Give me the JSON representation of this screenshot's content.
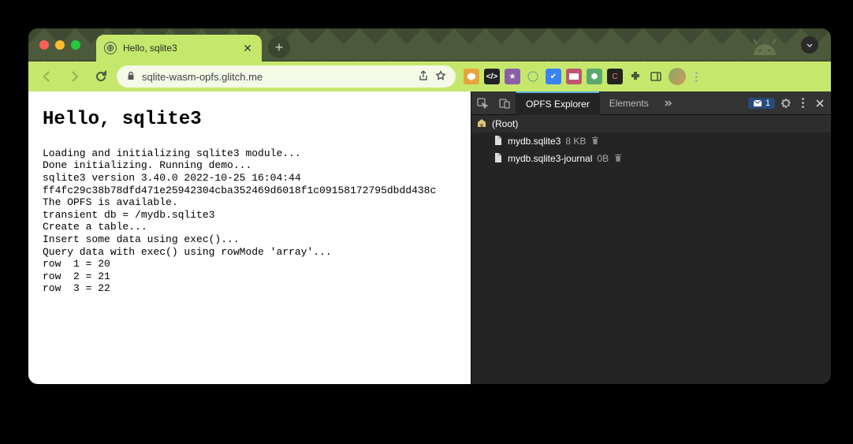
{
  "window": {
    "tab_title": "Hello, sqlite3"
  },
  "toolbar": {
    "url": "sqlite-wasm-opfs.glitch.me"
  },
  "page": {
    "heading": "Hello, sqlite3",
    "log": [
      "Loading and initializing sqlite3 module...",
      "Done initializing. Running demo...",
      "sqlite3 version 3.40.0 2022-10-25 16:04:44",
      "ff4fc29c38b78dfd471e25942304cba352469d6018f1c09158172795dbdd438c",
      "The OPFS is available.",
      "transient db = /mydb.sqlite3",
      "Create a table...",
      "Insert some data using exec()...",
      "Query data with exec() using rowMode 'array'...",
      "row  1 = 20",
      "row  2 = 21",
      "row  3 = 22"
    ]
  },
  "devtools": {
    "tabs": {
      "active": "OPFS Explorer",
      "other": "Elements"
    },
    "console_badge_count": "1",
    "tree": {
      "root_label": "(Root)",
      "files": [
        {
          "name": "mydb.sqlite3",
          "size": "8 KB"
        },
        {
          "name": "mydb.sqlite3-journal",
          "size": "0B"
        }
      ]
    }
  }
}
